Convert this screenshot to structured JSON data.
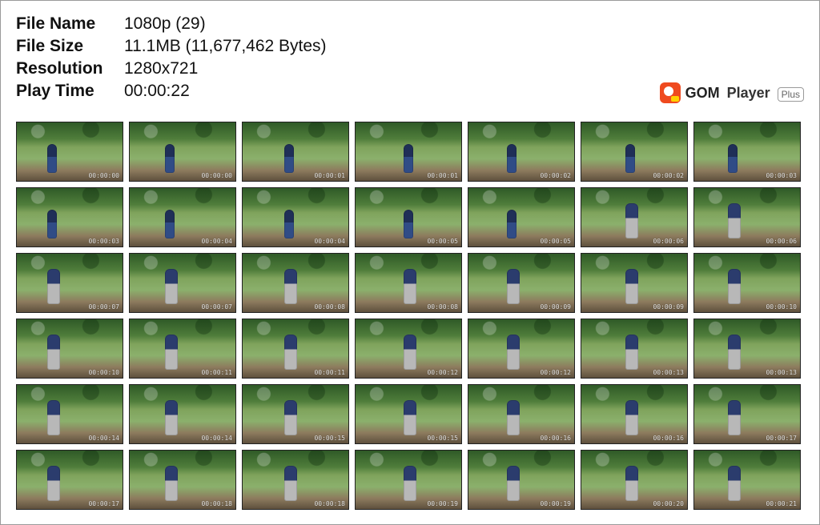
{
  "info": {
    "file_name_label": "File Name",
    "file_name_value": "1080p (29)",
    "file_size_label": "File Size",
    "file_size_value": "11.1MB (11,677,462 Bytes)",
    "resolution_label": "Resolution",
    "resolution_value": "1280x721",
    "play_time_label": "Play Time",
    "play_time_value": "00:00:22"
  },
  "logo": {
    "gom": "GOM",
    "player": "Player",
    "plus": "Plus"
  },
  "thumbnails": [
    {
      "timestamp": "00:00:00",
      "subject": "child"
    },
    {
      "timestamp": "00:00:00",
      "subject": "child"
    },
    {
      "timestamp": "00:00:01",
      "subject": "child"
    },
    {
      "timestamp": "00:00:01",
      "subject": "child"
    },
    {
      "timestamp": "00:00:02",
      "subject": "child"
    },
    {
      "timestamp": "00:00:02",
      "subject": "child"
    },
    {
      "timestamp": "00:00:03",
      "subject": "child"
    },
    {
      "timestamp": "00:00:03",
      "subject": "child"
    },
    {
      "timestamp": "00:00:04",
      "subject": "child"
    },
    {
      "timestamp": "00:00:04",
      "subject": "child"
    },
    {
      "timestamp": "00:00:05",
      "subject": "child"
    },
    {
      "timestamp": "00:00:05",
      "subject": "child"
    },
    {
      "timestamp": "00:00:06",
      "subject": "adult"
    },
    {
      "timestamp": "00:00:06",
      "subject": "adult"
    },
    {
      "timestamp": "00:00:07",
      "subject": "adult"
    },
    {
      "timestamp": "00:00:07",
      "subject": "adult"
    },
    {
      "timestamp": "00:00:08",
      "subject": "adult"
    },
    {
      "timestamp": "00:00:08",
      "subject": "adult"
    },
    {
      "timestamp": "00:00:09",
      "subject": "adult"
    },
    {
      "timestamp": "00:00:09",
      "subject": "adult"
    },
    {
      "timestamp": "00:00:10",
      "subject": "adult"
    },
    {
      "timestamp": "00:00:10",
      "subject": "adult"
    },
    {
      "timestamp": "00:00:11",
      "subject": "adult"
    },
    {
      "timestamp": "00:00:11",
      "subject": "adult"
    },
    {
      "timestamp": "00:00:12",
      "subject": "adult"
    },
    {
      "timestamp": "00:00:12",
      "subject": "adult"
    },
    {
      "timestamp": "00:00:13",
      "subject": "adult"
    },
    {
      "timestamp": "00:00:13",
      "subject": "adult"
    },
    {
      "timestamp": "00:00:14",
      "subject": "adult"
    },
    {
      "timestamp": "00:00:14",
      "subject": "adult"
    },
    {
      "timestamp": "00:00:15",
      "subject": "adult"
    },
    {
      "timestamp": "00:00:15",
      "subject": "adult"
    },
    {
      "timestamp": "00:00:16",
      "subject": "adult"
    },
    {
      "timestamp": "00:00:16",
      "subject": "adult"
    },
    {
      "timestamp": "00:00:17",
      "subject": "adult"
    },
    {
      "timestamp": "00:00:17",
      "subject": "adult"
    },
    {
      "timestamp": "00:00:18",
      "subject": "adult"
    },
    {
      "timestamp": "00:00:18",
      "subject": "adult"
    },
    {
      "timestamp": "00:00:19",
      "subject": "adult"
    },
    {
      "timestamp": "00:00:19",
      "subject": "adult"
    },
    {
      "timestamp": "00:00:20",
      "subject": "adult"
    },
    {
      "timestamp": "00:00:21",
      "subject": "adult"
    }
  ]
}
